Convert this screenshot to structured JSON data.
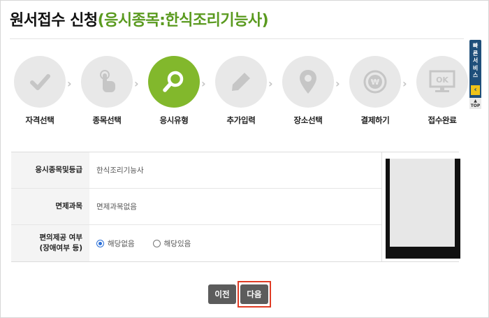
{
  "header": {
    "title_main": "원서접수 신청",
    "title_sub": "(응시종목:한식조리기능사)"
  },
  "steps": [
    {
      "label": "자격선택",
      "icon": "check-icon",
      "active": false
    },
    {
      "label": "종목선택",
      "icon": "touch-icon",
      "active": false
    },
    {
      "label": "응시유형",
      "icon": "search-icon",
      "active": true
    },
    {
      "label": "추가입력",
      "icon": "pencil-icon",
      "active": false
    },
    {
      "label": "장소선택",
      "icon": "location-pin-icon",
      "active": false
    },
    {
      "label": "결제하기",
      "icon": "won-coin-icon",
      "active": false
    },
    {
      "label": "접수완료",
      "icon": "ok-monitor-icon",
      "active": false
    }
  ],
  "form": {
    "exam_label": "응시종목및등급",
    "exam_value": "한식조리기능사",
    "exempt_label": "면제과목",
    "exempt_value": "면제과목없음",
    "accommodation_label_1": "편의제공 여부",
    "accommodation_label_2": "(장애여부 등)",
    "options": [
      {
        "label": "해당없음",
        "checked": true
      },
      {
        "label": "해당있음",
        "checked": false
      }
    ]
  },
  "buttons": {
    "prev": "이전",
    "next": "다음"
  },
  "side": {
    "quick_service": "빠른서비스",
    "top": "TOP"
  },
  "colors": {
    "accent_green": "#82b82c",
    "title_green": "#5a9a1f",
    "button_gray": "#5c5c5c",
    "highlight_red": "#e03b24",
    "quick_navy": "#1f4f7a"
  }
}
